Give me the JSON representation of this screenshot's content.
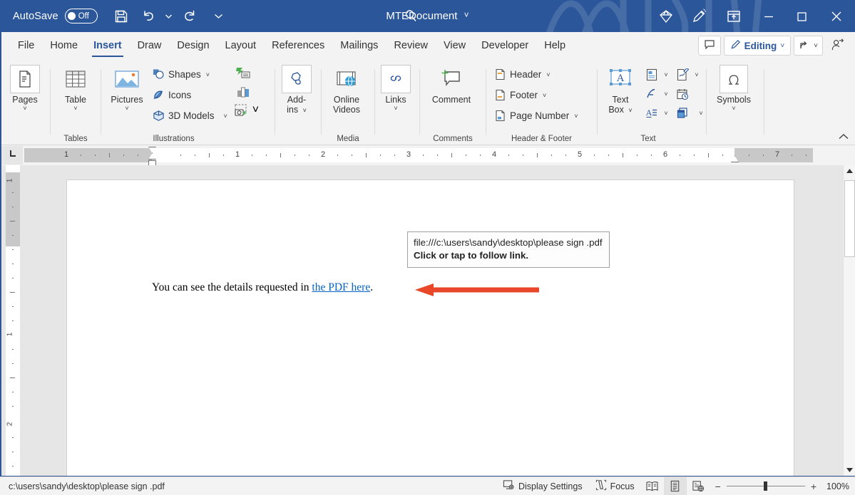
{
  "titlebar": {
    "autosave_label": "AutoSave",
    "autosave_state": "Off",
    "save_icon": "save-icon",
    "undo_icon": "undo-icon",
    "redo_icon": "redo-icon",
    "customize_icon": "customize-quick-access-icon",
    "document_title": "MTEDocument",
    "title_caret": "˅",
    "search_icon": "search-icon",
    "diamond_icon": "diamond-icon",
    "pen_icon": "pen-draw-icon",
    "ribbon_display_icon": "ribbon-display-options-icon",
    "minimize_icon": "minimize-icon",
    "maximize_icon": "maximize-icon",
    "close_icon": "close-icon",
    "bg_color": "#2b579a"
  },
  "ribbon_tabs": {
    "items": [
      {
        "label": "File",
        "active": false
      },
      {
        "label": "Home",
        "active": false
      },
      {
        "label": "Insert",
        "active": true
      },
      {
        "label": "Draw",
        "active": false
      },
      {
        "label": "Design",
        "active": false
      },
      {
        "label": "Layout",
        "active": false
      },
      {
        "label": "References",
        "active": false
      },
      {
        "label": "Mailings",
        "active": false
      },
      {
        "label": "Review",
        "active": false
      },
      {
        "label": "View",
        "active": false
      },
      {
        "label": "Developer",
        "active": false
      },
      {
        "label": "Help",
        "active": false
      }
    ],
    "comment_icon": "comment-icon",
    "editing_label": "Editing",
    "editing_icon": "pencil-icon",
    "editing_caret": "˅",
    "share_icon": "share-icon",
    "share_caret": "˅",
    "catchup_icon": "catch-up-person-icon",
    "accent_color": "#2b579a"
  },
  "ribbon": {
    "groups": [
      {
        "title": "",
        "name": "pages-group",
        "buttons": [
          {
            "label": "Pages",
            "label2": "",
            "caret": "˅",
            "icon": "pages-icon"
          }
        ]
      },
      {
        "title": "Tables",
        "name": "tables-group",
        "buttons": [
          {
            "label": "Table",
            "label2": "",
            "caret": "˅",
            "icon": "table-icon"
          }
        ]
      },
      {
        "title": "Illustrations",
        "name": "illustrations-group",
        "buttons": [
          {
            "label": "Pictures",
            "label2": "",
            "caret": "˅",
            "icon": "pictures-icon"
          }
        ],
        "small_items": [
          {
            "label": "Shapes",
            "icon": "shapes-icon",
            "caret": "˅"
          },
          {
            "label": "Icons",
            "icon": "icons-icon",
            "caret": ""
          },
          {
            "label": "3D Models",
            "icon": "3d-models-icon",
            "caret": "˅"
          }
        ],
        "mini_icons": [
          {
            "icon": "smartart-icon",
            "caret": ""
          },
          {
            "icon": "chart-icon",
            "caret": ""
          },
          {
            "icon": "screenshot-icon",
            "caret": "˅"
          }
        ]
      },
      {
        "title": "",
        "name": "addins-group",
        "buttons": [
          {
            "label": "Add-",
            "label2": "ins",
            "caret": "˅",
            "icon": "add-ins-icon"
          }
        ]
      },
      {
        "title": "Media",
        "name": "media-group",
        "buttons": [
          {
            "label": "Online",
            "label2": "Videos",
            "caret": "",
            "icon": "online-videos-icon"
          }
        ]
      },
      {
        "title": "",
        "name": "links-group",
        "buttons": [
          {
            "label": "Links",
            "label2": "",
            "caret": "˅",
            "icon": "links-icon"
          }
        ]
      },
      {
        "title": "Comments",
        "name": "comments-group",
        "buttons": [
          {
            "label": "Comment",
            "label2": "",
            "caret": "",
            "icon": "new-comment-icon"
          }
        ]
      },
      {
        "title": "Header & Footer",
        "name": "header-footer-group",
        "small_items": [
          {
            "label": "Header",
            "icon": "header-icon",
            "caret": "˅"
          },
          {
            "label": "Footer",
            "icon": "footer-icon",
            "caret": "˅"
          },
          {
            "label": "Page Number",
            "icon": "page-number-icon",
            "caret": "˅"
          }
        ]
      },
      {
        "title": "Text",
        "name": "text-group",
        "buttons": [
          {
            "label": "Text",
            "label2": "Box",
            "caret": "˅",
            "icon": "text-box-icon"
          }
        ],
        "grid_icons": [
          {
            "icon": "quick-parts-icon",
            "caret": "˅"
          },
          {
            "icon": "signature-line-icon",
            "caret": "˅"
          },
          {
            "icon": "wordart-icon",
            "caret": "˅"
          },
          {
            "icon": "date-time-icon",
            "caret": ""
          },
          {
            "icon": "drop-cap-icon",
            "caret": "˅"
          },
          {
            "icon": "object-icon",
            "caret": "˅"
          }
        ]
      },
      {
        "title": "",
        "name": "symbols-group",
        "buttons": [
          {
            "label": "Symbols",
            "label2": "",
            "caret": "˅",
            "icon": "symbols-omega-icon"
          }
        ]
      }
    ],
    "collapse_icon": "collapse-ribbon-chevron-icon"
  },
  "ruler": {
    "tabstop_icon": "left-tab-stop-icon",
    "horizontal_numbers": [
      "1",
      "1",
      "2",
      "3",
      "4",
      "5",
      "6",
      "7"
    ],
    "vertical_numbers": [
      "1",
      "1",
      "2"
    ],
    "indent_markers": [
      "first-line-indent-marker",
      "hanging-indent-marker",
      "left-indent-marker",
      "right-indent-marker"
    ]
  },
  "document": {
    "text_before": "You can see the details requested in ",
    "link_text": "the PDF here",
    "text_after": ".",
    "link_color": "#0563c1",
    "tooltip": {
      "url": "file:///c:\\users\\sandy\\desktop\\please sign .pdf",
      "action": "Click or tap to follow link."
    },
    "annotation_arrow": "red-arrow-annotation",
    "annotation_color": "#e8472a"
  },
  "scrollbar": {
    "up_icon": "scroll-up-arrow-icon",
    "down_icon": "scroll-down-arrow-icon",
    "thumb": "vertical-scroll-thumb"
  },
  "statusbar": {
    "path": "c:\\users\\sandy\\desktop\\please sign .pdf",
    "display_settings_label": "Display Settings",
    "display_settings_icon": "display-settings-icon",
    "focus_label": "Focus",
    "focus_icon": "focus-mode-icon",
    "view_read_icon": "read-mode-icon",
    "view_print_icon": "print-layout-icon",
    "view_web_icon": "web-layout-icon",
    "zoom_out_sign": "−",
    "zoom_in_sign": "+",
    "zoom_percent": "100%"
  }
}
